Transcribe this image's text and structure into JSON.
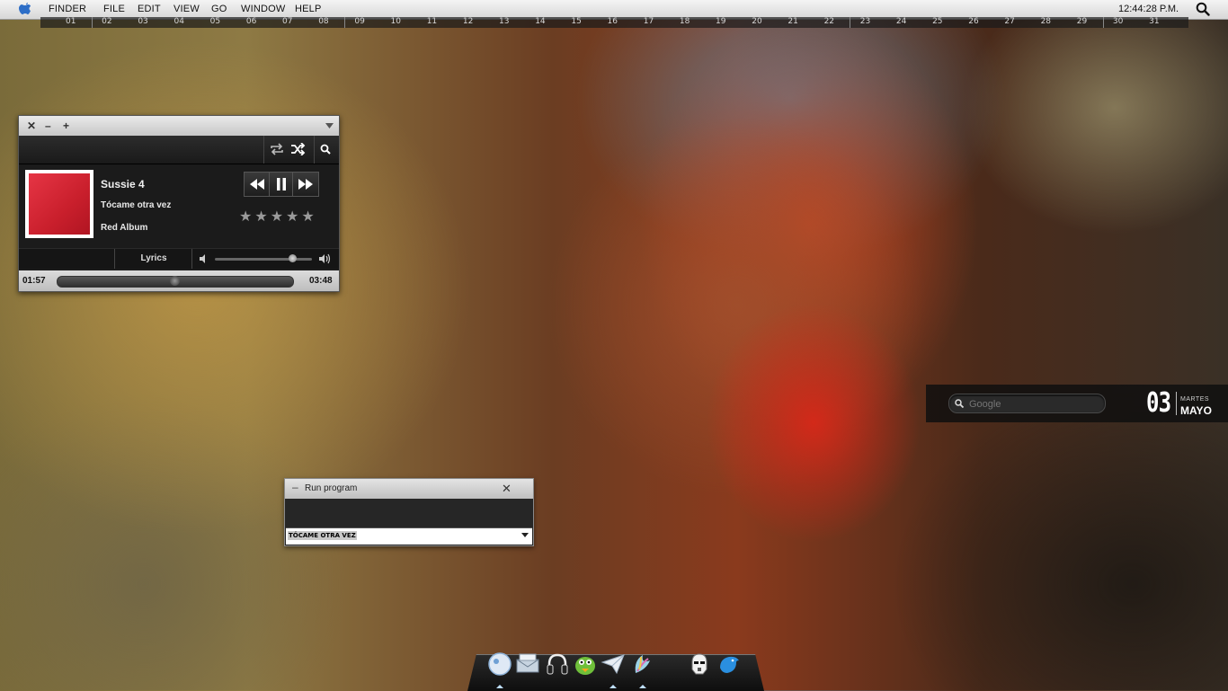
{
  "menubar": {
    "items": [
      "FINDER",
      "FILE",
      "EDIT",
      "VIEW",
      "GO",
      "WINDOW",
      "HELP"
    ],
    "clock": "12:44:28 P.M."
  },
  "calendar_strip": {
    "days": [
      "01",
      "02",
      "03",
      "04",
      "05",
      "06",
      "07",
      "08",
      "09",
      "10",
      "11",
      "12",
      "13",
      "14",
      "15",
      "16",
      "17",
      "18",
      "19",
      "20",
      "21",
      "22",
      "23",
      "24",
      "25",
      "26",
      "27",
      "28",
      "29",
      "30",
      "31"
    ]
  },
  "music_widget": {
    "title": "Sussie 4",
    "song": "Tócame otra vez",
    "album": "Red Album",
    "stars": "★★★★★",
    "lyrics_label": "Lyrics",
    "elapsed": "01:57",
    "duration": "03:48",
    "progress_fraction": 0.51,
    "volume_fraction": 0.8
  },
  "search_widget": {
    "placeholder": "Google",
    "day_number": "03",
    "day_name": "MARTES",
    "month": "MAYO"
  },
  "run_program": {
    "title": "Run program",
    "field_value": "TÓCAME OTRA VEZ"
  },
  "dock": {
    "icons": [
      "finder-icon",
      "mail-icon",
      "headphones-icon",
      "adium-icon",
      "airmail-icon",
      "feather-icon",
      "stormtrooper-icon",
      "twitter-icon"
    ]
  },
  "colors": {
    "album_red": "#d8283a",
    "accent_light": "#bfe0ff"
  }
}
